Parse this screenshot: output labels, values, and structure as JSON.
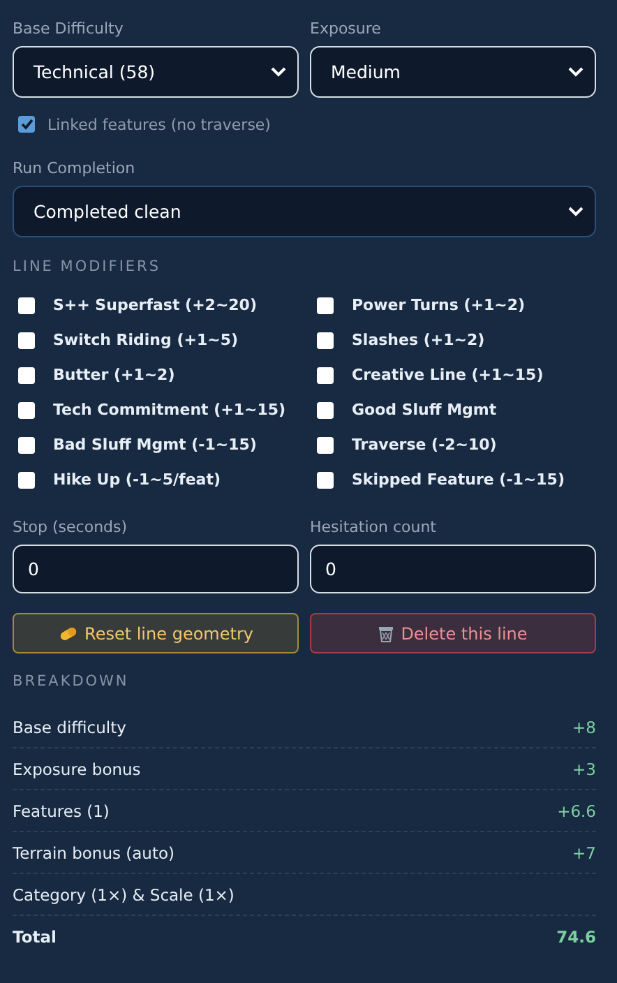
{
  "base_difficulty": {
    "label": "Base Difficulty",
    "value": "Technical (58)"
  },
  "exposure": {
    "label": "Exposure",
    "value": "Medium"
  },
  "linked_features": {
    "label": "Linked features (no traverse)",
    "checked": true
  },
  "run_completion": {
    "label": "Run Completion",
    "value": "Completed clean"
  },
  "line_modifiers": {
    "title": "LINE MODIFIERS",
    "items": [
      {
        "label": "S++ Superfast (+2~20)",
        "checked": false
      },
      {
        "label": "Power Turns (+1~2)",
        "checked": false
      },
      {
        "label": "Switch Riding (+1~5)",
        "checked": false
      },
      {
        "label": "Slashes (+1~2)",
        "checked": false
      },
      {
        "label": "Butter (+1~2)",
        "checked": false
      },
      {
        "label": "Creative Line (+1~15)",
        "checked": false
      },
      {
        "label": "Tech Commitment (+1~15)",
        "checked": false
      },
      {
        "label": "Good Sluff Mgmt",
        "checked": false
      },
      {
        "label": "Bad Sluff Mgmt (-1~15)",
        "checked": false
      },
      {
        "label": "Traverse (-2~10)",
        "checked": false
      },
      {
        "label": "Hike Up (-1~5/feat)",
        "checked": false
      },
      {
        "label": "Skipped Feature (-1~15)",
        "checked": false
      }
    ]
  },
  "stop": {
    "label": "Stop (seconds)",
    "value": "0"
  },
  "hesitation": {
    "label": "Hesitation count",
    "value": "0"
  },
  "buttons": [
    {
      "label": "Reset line geometry",
      "kind": "reset"
    },
    {
      "label": "Delete this line",
      "kind": "delete"
    }
  ],
  "breakdown": {
    "title": "BREAKDOWN",
    "rows": [
      {
        "label": "Base difficulty",
        "value": "+8",
        "kind": "item"
      },
      {
        "label": "Exposure bonus",
        "value": "+3",
        "kind": "item"
      },
      {
        "label": "Features (1)",
        "value": "+6.6",
        "kind": "item"
      },
      {
        "label": "Terrain bonus (auto)",
        "value": "+7",
        "kind": "item"
      },
      {
        "label": "Category (1×) & Scale (1×)",
        "kind": "item"
      },
      {
        "label": "Total",
        "value": "74.6",
        "kind": "total"
      }
    ]
  }
}
